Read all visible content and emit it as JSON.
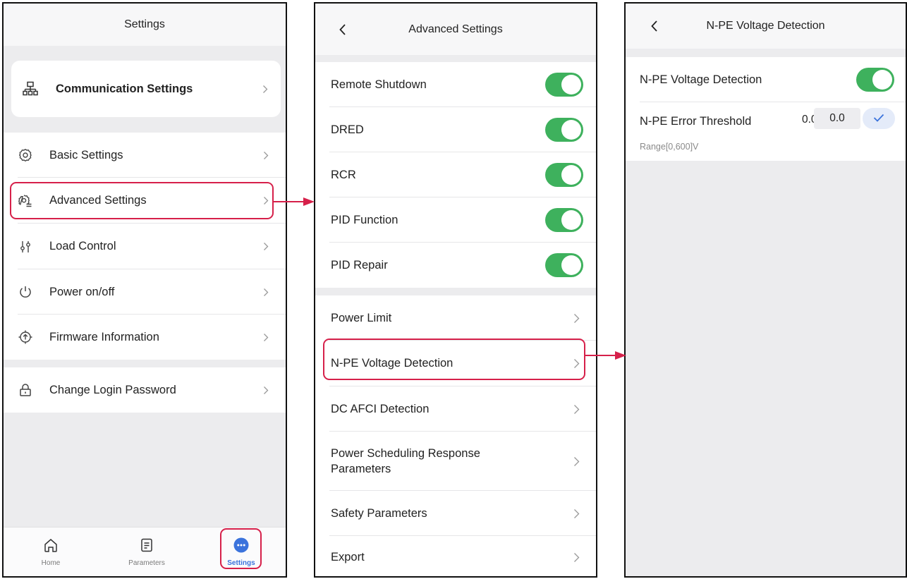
{
  "colors": {
    "accent_green": "#3eb15d",
    "highlight_red": "#d6204a",
    "tab_active_blue": "#3b73dc"
  },
  "screen1": {
    "title": "Settings",
    "card_item": {
      "label": "Communication Settings",
      "icon": "network-icon"
    },
    "items": [
      {
        "label": "Basic Settings",
        "icon": "gear-icon"
      },
      {
        "label": "Advanced Settings",
        "icon": "advanced-gear-icon"
      },
      {
        "label": "Load Control",
        "icon": "sliders-icon"
      },
      {
        "label": "Power on/off",
        "icon": "power-icon"
      },
      {
        "label": "Firmware Information",
        "icon": "firmware-upload-icon"
      },
      {
        "label": "Change Login Password",
        "icon": "lock-icon"
      }
    ],
    "tabs": [
      {
        "label": "Home",
        "icon": "home-icon",
        "active": false
      },
      {
        "label": "Parameters",
        "icon": "document-icon",
        "active": false
      },
      {
        "label": "Settings",
        "icon": "more-dots-icon",
        "active": true
      }
    ]
  },
  "screen2": {
    "title": "Advanced Settings",
    "toggles": [
      {
        "label": "Remote Shutdown",
        "on": true
      },
      {
        "label": "DRED",
        "on": true
      },
      {
        "label": "RCR",
        "on": true
      },
      {
        "label": "PID Function",
        "on": true
      },
      {
        "label": "PID Repair",
        "on": true
      }
    ],
    "links": [
      {
        "label": "Power Limit"
      },
      {
        "label": "N-PE Voltage Detection"
      },
      {
        "label": "DC AFCI Detection"
      },
      {
        "label": "Power Scheduling Response\nParameters"
      },
      {
        "label": "Safety Parameters"
      },
      {
        "label": "Export"
      }
    ]
  },
  "screen3": {
    "title": "N-PE Voltage Detection",
    "toggle": {
      "label": "N-PE Voltage Detection",
      "on": true
    },
    "threshold": {
      "label": "N-PE Error Threshold",
      "current_value": "0.0",
      "input_value": "0.0",
      "range_hint": "Range[0,600]V"
    }
  }
}
